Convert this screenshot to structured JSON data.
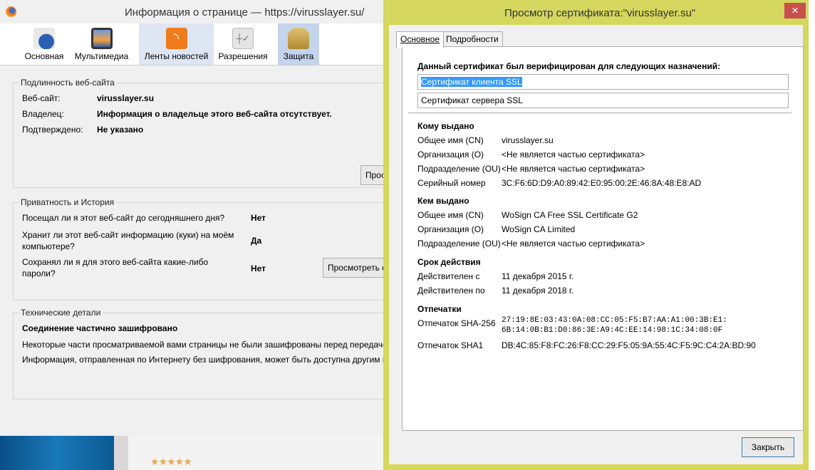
{
  "page_info": {
    "title": "Информация о странице — https://virusslayer.su/",
    "tabs": [
      {
        "label": "Основная",
        "icon": "info-icon"
      },
      {
        "label": "Мультимедиа",
        "icon": "media-icon"
      },
      {
        "label": "Ленты новостей",
        "icon": "rss-icon"
      },
      {
        "label": "Разрешения",
        "icon": "permissions-icon"
      },
      {
        "label": "Защита",
        "icon": "lock-icon"
      }
    ],
    "identity": {
      "heading": "Подлинность веб-сайта",
      "website_label": "Веб-сайт:",
      "website": "virusslayer.su",
      "owner_label": "Владелец:",
      "owner": "Информация о владельце этого веб-сайта отсутствует.",
      "verified_label": "Подтверждено:",
      "verified": "Не указано",
      "button": "Просмотреть сертификат"
    },
    "privacy": {
      "heading": "Приватность и История",
      "q1": "Посещал ли я этот веб-сайт до сегодняшнего дня?",
      "a1": "Нет",
      "q2a": "Хранит ли этот веб-сайт информацию (куки) на моём",
      "q2b": "компьютере?",
      "a2": "Да",
      "q3a": "Сохранял ли я для этого веб-сайта какие-либо",
      "q3b": "пароли?",
      "a3": "Нет",
      "button": "Просмотреть сохранённые пароли"
    },
    "technical": {
      "heading": "Технические детали",
      "status": "Соединение частично зашифровано",
      "line1": "Некоторые части просматриваемой вами страницы не были зашифрованы перед передачей",
      "line2": "Информация, отправленная по Интернету без шифрования, может быть доступна другим владельцам"
    },
    "rating": "★★★★★"
  },
  "cert": {
    "title": "Просмотр сертификата:\"virusslayer.su\"",
    "tabs": [
      "Основное",
      "Подробности"
    ],
    "verified_heading": "Данный сертификат был верифицирован для следующих назначений:",
    "usages": [
      "Сертификат клиента SSL",
      "Сертификат сервера SSL"
    ],
    "issued_to": {
      "heading": "Кому выдано",
      "rows": [
        [
          "Общее имя (CN)",
          "virusslayer.su"
        ],
        [
          "Организация (O)",
          "<Не является частью сертификата>"
        ],
        [
          "Подразделение (OU)",
          "<Не является частью сертификата>"
        ],
        [
          "Серийный номер",
          "3C:F6:6D:D9:A0:89:42:E0:95:00:2E:46:8A:48:E8:AD"
        ]
      ]
    },
    "issued_by": {
      "heading": "Кем выдано",
      "rows": [
        [
          "Общее имя (CN)",
          "WoSign CA Free SSL Certificate G2"
        ],
        [
          "Организация (O)",
          "WoSign CA Limited"
        ],
        [
          "Подразделение (OU)",
          "<Не является частью сертификата>"
        ]
      ]
    },
    "validity": {
      "heading": "Срок действия",
      "rows": [
        [
          "Действителен с",
          "11 декабря 2015 г."
        ],
        [
          "Действителен по",
          "11 декабря 2018 г."
        ]
      ]
    },
    "fingerprints": {
      "heading": "Отпечатки",
      "sha256_label": "Отпечаток SHA-256",
      "sha256_1": "27:19:8E:03:43:0A:08:CC:05:F5:B7:AA:A1:00:3B:E1:",
      "sha256_2": "6B:14:0B:B1:D0:86:3E:A9:4C:EE:14:98:1C:34:08:0F",
      "sha1_label": "Отпечаток SHA1",
      "sha1": "DB:4C:85:F8:FC:26:F8:CC:29:F5:05:9A:55:4C:F5:9C:C4:2A:BD:90"
    },
    "close_button": "Закрыть",
    "close_x": "×"
  }
}
